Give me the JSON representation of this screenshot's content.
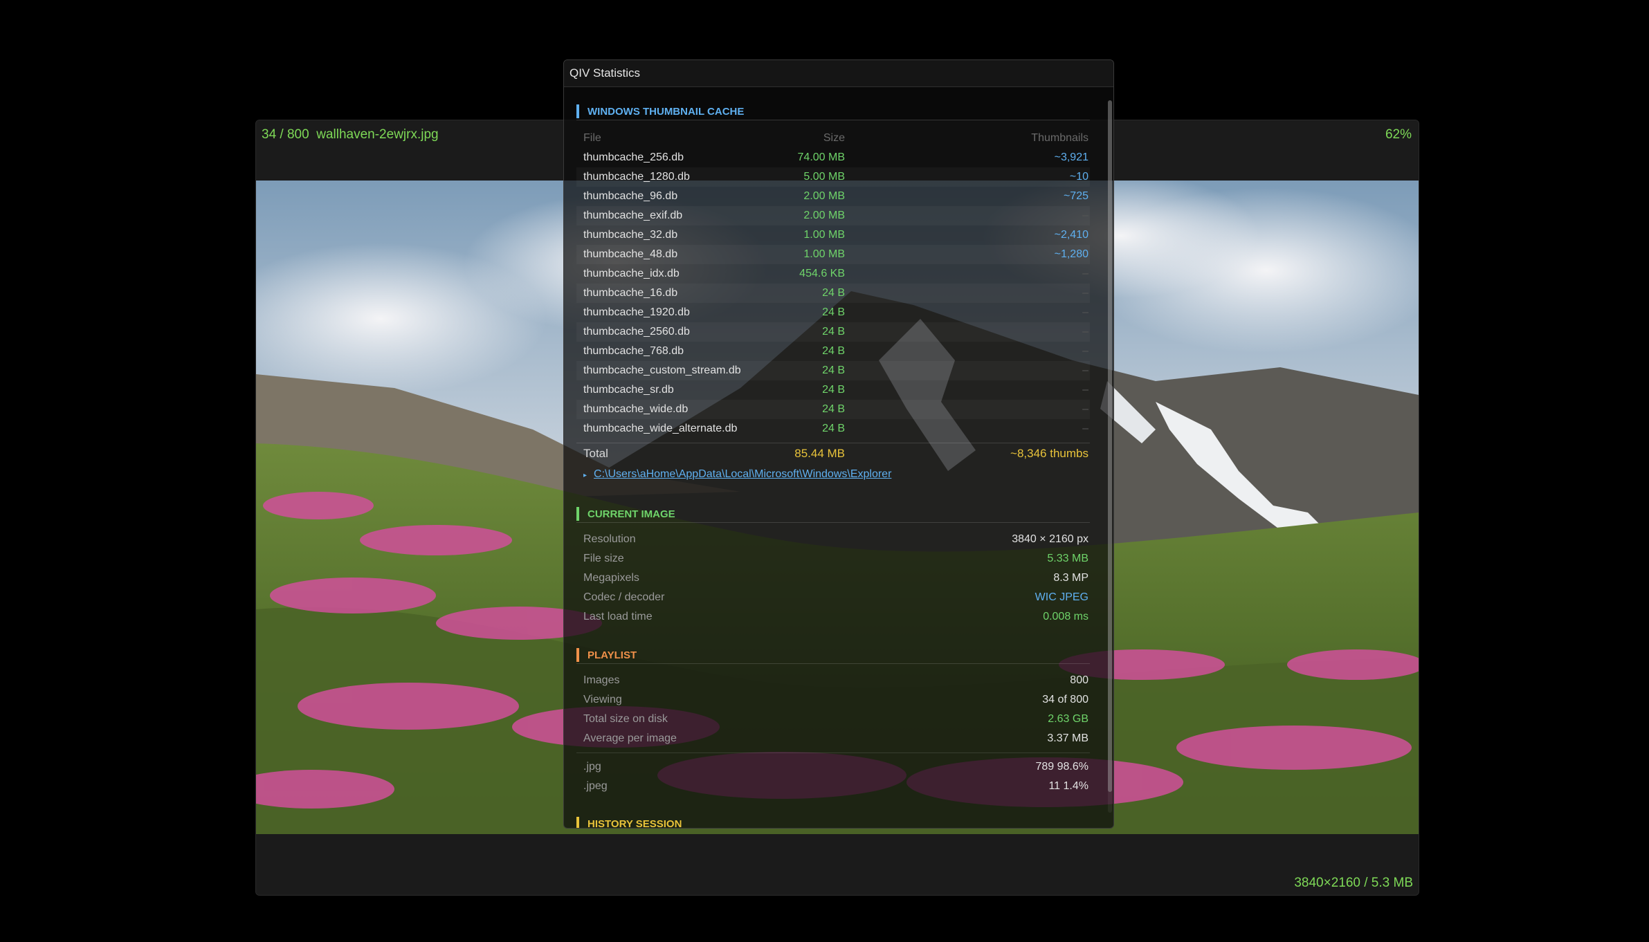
{
  "viewer": {
    "counter": "34 / 800",
    "filename": "wallhaven-2ewjrx.jpg",
    "zoom": "62%",
    "image_info": "3840×2160 / 5.3 MB"
  },
  "stats": {
    "title": "QIV Statistics",
    "thumbnail_cache": {
      "heading": "WINDOWS THUMBNAIL CACHE",
      "columns": {
        "file": "File",
        "size": "Size",
        "thumbnails": "Thumbnails"
      },
      "rows": [
        {
          "file": "thumbcache_256.db",
          "size": "74.00 MB",
          "thumbs": "~3,921"
        },
        {
          "file": "thumbcache_1280.db",
          "size": "5.00 MB",
          "thumbs": "~10"
        },
        {
          "file": "thumbcache_96.db",
          "size": "2.00 MB",
          "thumbs": "~725"
        },
        {
          "file": "thumbcache_exif.db",
          "size": "2.00 MB",
          "thumbs": "–"
        },
        {
          "file": "thumbcache_32.db",
          "size": "1.00 MB",
          "thumbs": "~2,410"
        },
        {
          "file": "thumbcache_48.db",
          "size": "1.00 MB",
          "thumbs": "~1,280"
        },
        {
          "file": "thumbcache_idx.db",
          "size": "454.6 KB",
          "thumbs": "–"
        },
        {
          "file": "thumbcache_16.db",
          "size": "24 B",
          "thumbs": "–"
        },
        {
          "file": "thumbcache_1920.db",
          "size": "24 B",
          "thumbs": "–"
        },
        {
          "file": "thumbcache_2560.db",
          "size": "24 B",
          "thumbs": "–"
        },
        {
          "file": "thumbcache_768.db",
          "size": "24 B",
          "thumbs": "–"
        },
        {
          "file": "thumbcache_custom_stream.db",
          "size": "24 B",
          "thumbs": "–"
        },
        {
          "file": "thumbcache_sr.db",
          "size": "24 B",
          "thumbs": "–"
        },
        {
          "file": "thumbcache_wide.db",
          "size": "24 B",
          "thumbs": "–"
        },
        {
          "file": "thumbcache_wide_alternate.db",
          "size": "24 B",
          "thumbs": "–"
        }
      ],
      "total_label": "Total",
      "total_size": "85.44 MB",
      "total_thumbs": "~8,346 thumbs",
      "path": "C:\\Users\\aHome\\AppData\\Local\\Microsoft\\Windows\\Explorer"
    },
    "current_image": {
      "heading": "CURRENT IMAGE",
      "items": [
        {
          "label": "Resolution",
          "value": "3840 × 2160 px"
        },
        {
          "label": "File size",
          "value": "5.33 MB"
        },
        {
          "label": "Megapixels",
          "value": "8.3 MP"
        },
        {
          "label": "Codec / decoder",
          "value": "WIC JPEG"
        },
        {
          "label": "Last load time",
          "value": "0.008 ms"
        }
      ]
    },
    "playlist": {
      "heading": "PLAYLIST",
      "items": [
        {
          "label": "Images",
          "value": "800"
        },
        {
          "label": "Viewing",
          "value": "34  of  800"
        },
        {
          "label": "Total size on disk",
          "value": "2.63 GB"
        },
        {
          "label": "Average per image",
          "value": "3.37 MB"
        }
      ],
      "types": [
        {
          "label": ".jpg",
          "value": "789   98.6%"
        },
        {
          "label": ".jpeg",
          "value": "11   1.4%"
        }
      ]
    },
    "history": {
      "heading": "HISTORY  SESSION"
    }
  },
  "colors": {
    "accent_green": "#7ed957",
    "accent_blue": "#5fb0f0",
    "accent_orange": "#f0914a",
    "accent_yellow": "#e8c33a"
  }
}
